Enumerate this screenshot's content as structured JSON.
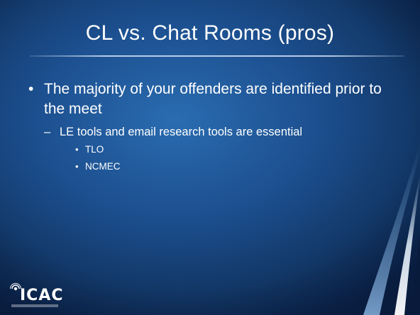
{
  "slide": {
    "title": "CL vs. Chat Rooms (pros)",
    "bullet": "The majority of your offenders are identified prior to the meet",
    "sub_bullet": "LE tools and email research tools are essential",
    "sub_sub_bullets": [
      "TLO",
      "NCMEC"
    ]
  },
  "logo": {
    "text": "ICAC"
  },
  "colors": {
    "background": "#1c4f8f",
    "text": "#ffffff"
  }
}
